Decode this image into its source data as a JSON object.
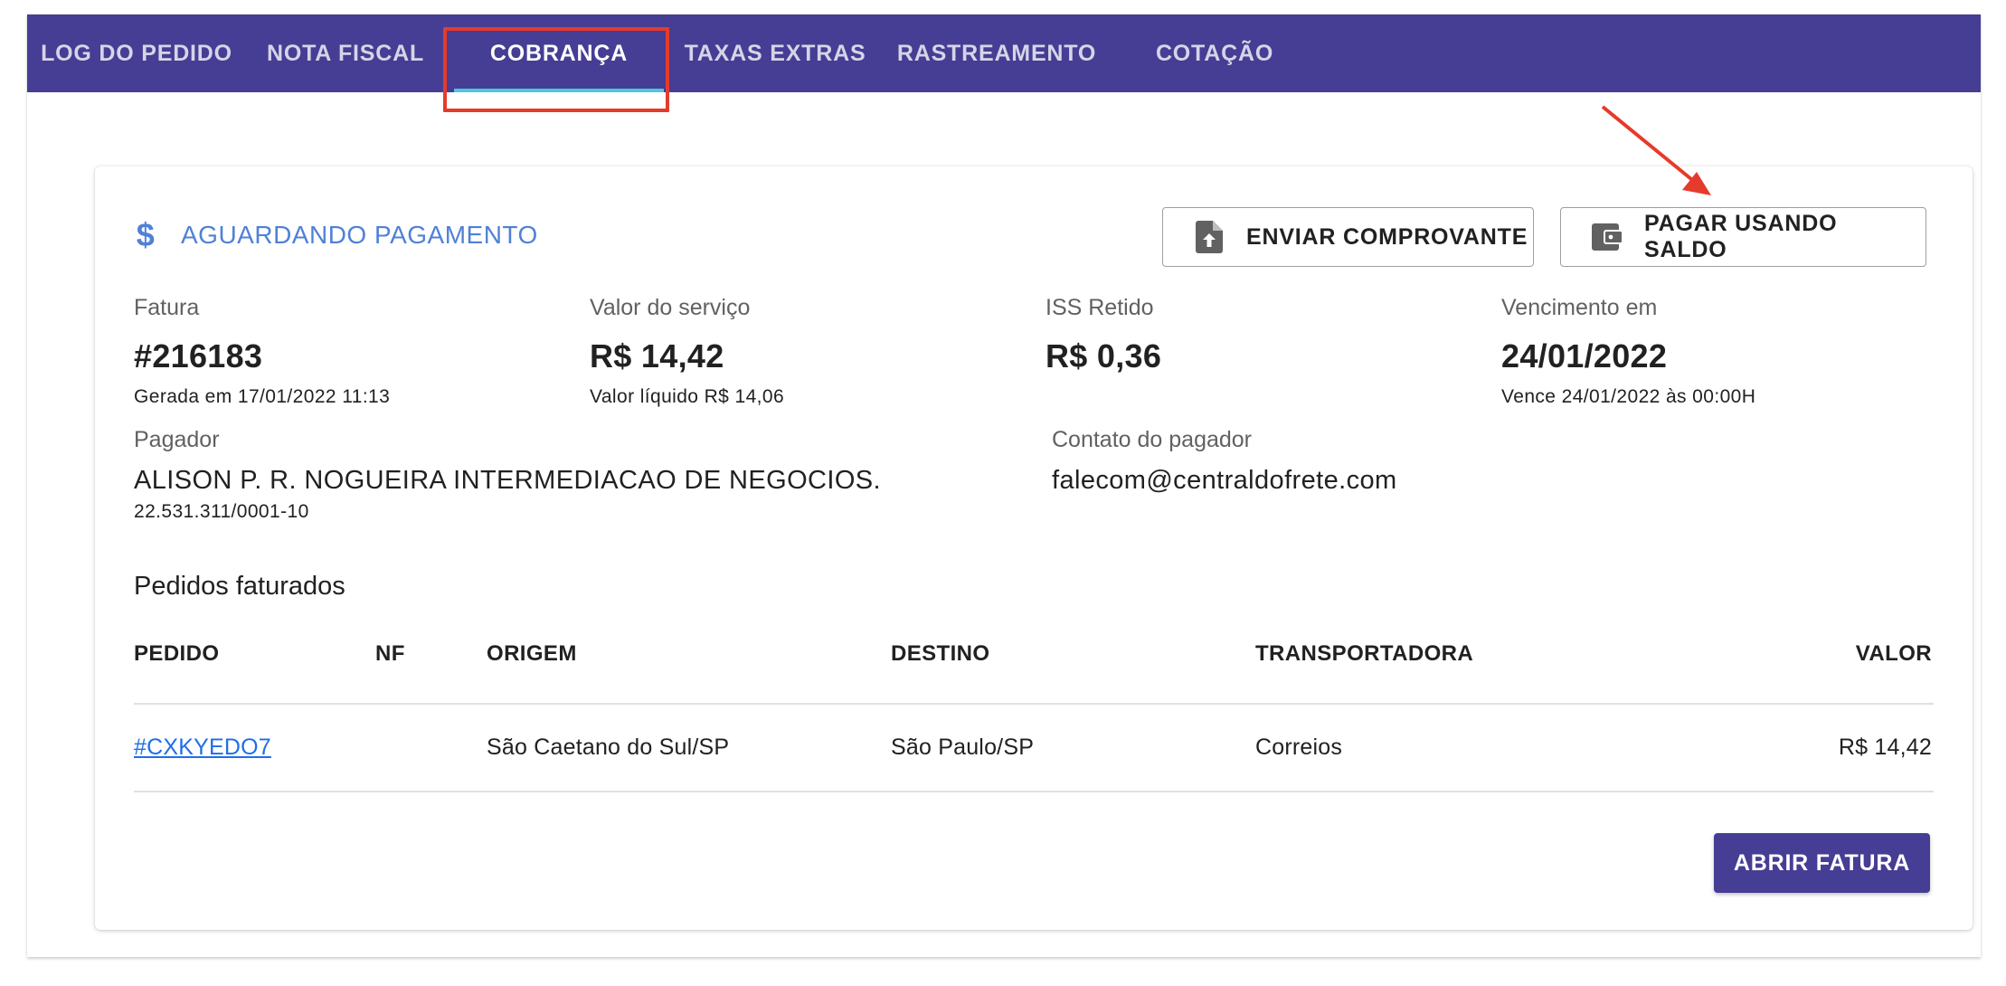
{
  "tabs": [
    {
      "label": "LOG DO PEDIDO"
    },
    {
      "label": "NOTA FISCAL"
    },
    {
      "label": "COBRANÇA"
    },
    {
      "label": "TAXAS EXTRAS"
    },
    {
      "label": "RASTREAMENTO"
    },
    {
      "label": "COTAÇÃO"
    }
  ],
  "active_tab": "COBRANÇA",
  "status": {
    "icon": "dollar-icon",
    "text": "AGUARDANDO PAGAMENTO"
  },
  "actions": {
    "send_receipt": {
      "label": "ENVIAR COMPROVANTE",
      "icon": "file-upload-icon"
    },
    "pay_balance": {
      "label": "PAGAR USANDO SALDO",
      "icon": "wallet-icon"
    }
  },
  "invoice": {
    "fatura": {
      "label": "Fatura",
      "value": "#216183",
      "sub": "Gerada em 17/01/2022 11:13"
    },
    "servico": {
      "label": "Valor do serviço",
      "value": "R$ 14,42",
      "sub": "Valor líquido R$ 14,06"
    },
    "iss": {
      "label": "ISS Retido",
      "value": "R$ 0,36"
    },
    "vencimento": {
      "label": "Vencimento em",
      "value": "24/01/2022",
      "sub": "Vence 24/01/2022 às 00:00H"
    }
  },
  "payer": {
    "label": "Pagador",
    "name": "ALISON P. R. NOGUEIRA INTERMEDIACAO DE NEGOCIOS.",
    "doc": "22.531.311/0001-10"
  },
  "contact": {
    "label": "Contato do pagador",
    "email": "falecom@centraldofrete.com"
  },
  "orders": {
    "title": "Pedidos faturados",
    "columns": {
      "pedido": "PEDIDO",
      "nf": "NF",
      "origem": "ORIGEM",
      "destino": "DESTINO",
      "transportadora": "TRANSPORTADORA",
      "valor": "VALOR"
    },
    "rows": [
      {
        "pedido": "#CXKYEDO7",
        "nf": "",
        "origem": "São Caetano do Sul/SP",
        "destino": "São Paulo/SP",
        "transportadora": "Correios",
        "valor": "R$ 14,42"
      }
    ]
  },
  "open_invoice": {
    "label": "ABRIR FATURA"
  },
  "colors": {
    "primary": "#463d94",
    "tab_indicator": "#4fc7e0",
    "status": "#5081d6",
    "link": "#1e6ee8",
    "highlight": "#e53b2c"
  }
}
